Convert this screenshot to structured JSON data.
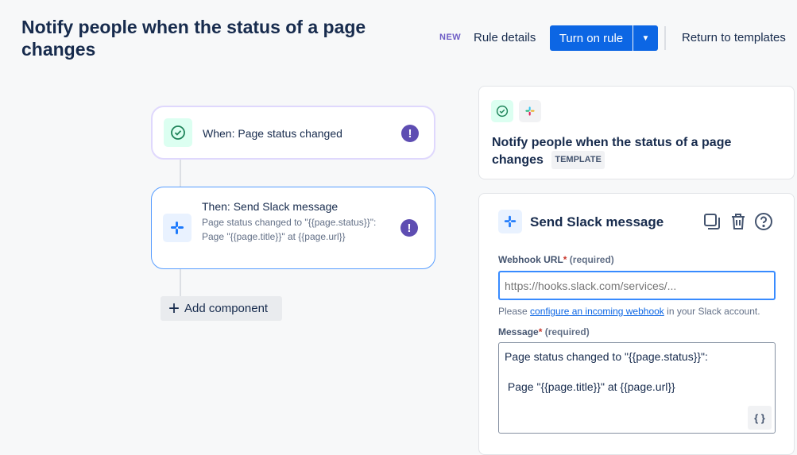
{
  "header": {
    "title": "Notify people when the status of a page changes",
    "new_badge": "NEW",
    "rule_details": "Rule details",
    "turn_on": "Turn on rule",
    "return": "Return to templates"
  },
  "flow": {
    "trigger": {
      "label": "When: Page status changed",
      "icon": "check-circle-icon"
    },
    "action": {
      "label": "Then: Send Slack message",
      "description": "Page status changed to \"{{page.status}}\": Page \"{{page.title}}\" at {{page.url}}",
      "icon": "slack-icon"
    },
    "add_component": "Add component"
  },
  "summary": {
    "title": "Notify people when the status of a page changes",
    "badge": "TEMPLATE"
  },
  "editor": {
    "title": "Send Slack message",
    "webhook": {
      "label": "Webhook URL",
      "required": "(required)",
      "placeholder": "https://hooks.slack.com/services/...",
      "help_prefix": "Please ",
      "help_link": "configure an incoming webhook",
      "help_suffix": " in your Slack account."
    },
    "message": {
      "label": "Message",
      "required": "(required)",
      "value": "Page status changed to \"{{page.status}}\":\n\n Page \"{{page.title}}\" at {{page.url}}",
      "smart_values": "{ }"
    }
  },
  "colors": {
    "primary": "#0c66e4",
    "warning": "#5e4db2",
    "trigger_bg": "#dcfff1",
    "action_bg": "#e9f2ff"
  }
}
